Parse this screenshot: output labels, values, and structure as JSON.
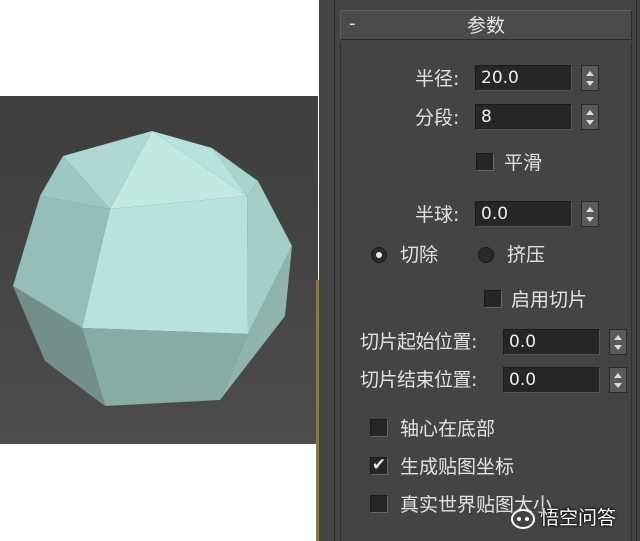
{
  "rollout": {
    "collapse_glyph": "-",
    "title": "参数"
  },
  "radius": {
    "label": "半径:",
    "value": "20.0"
  },
  "segments": {
    "label": "分段:",
    "value": "8"
  },
  "smooth": {
    "label": "平滑",
    "checked": false
  },
  "hemisphere": {
    "label": "半球:",
    "value": "0.0"
  },
  "hemi_mode": {
    "chop_label": "切除",
    "squash_label": "挤压",
    "selected": "chop"
  },
  "slice_on": {
    "label": "启用切片",
    "checked": false
  },
  "slice_from": {
    "label": "切片起始位置:",
    "value": "0.0"
  },
  "slice_to": {
    "label": "切片结束位置:",
    "value": "0.0"
  },
  "base_to_pivot": {
    "label": "轴心在底部",
    "checked": false
  },
  "gen_mapping": {
    "label": "生成贴图坐标",
    "checked": true
  },
  "real_world": {
    "label": "真实世界贴图大小",
    "checked": false
  },
  "watermark": {
    "text": "悟空问答",
    "icon": "wukong-logo-icon"
  },
  "colors": {
    "panel_bg": "#444444",
    "viewport_bg": "#474747",
    "sphere": "#a6d2ca",
    "accent": "#8b7a3c"
  }
}
